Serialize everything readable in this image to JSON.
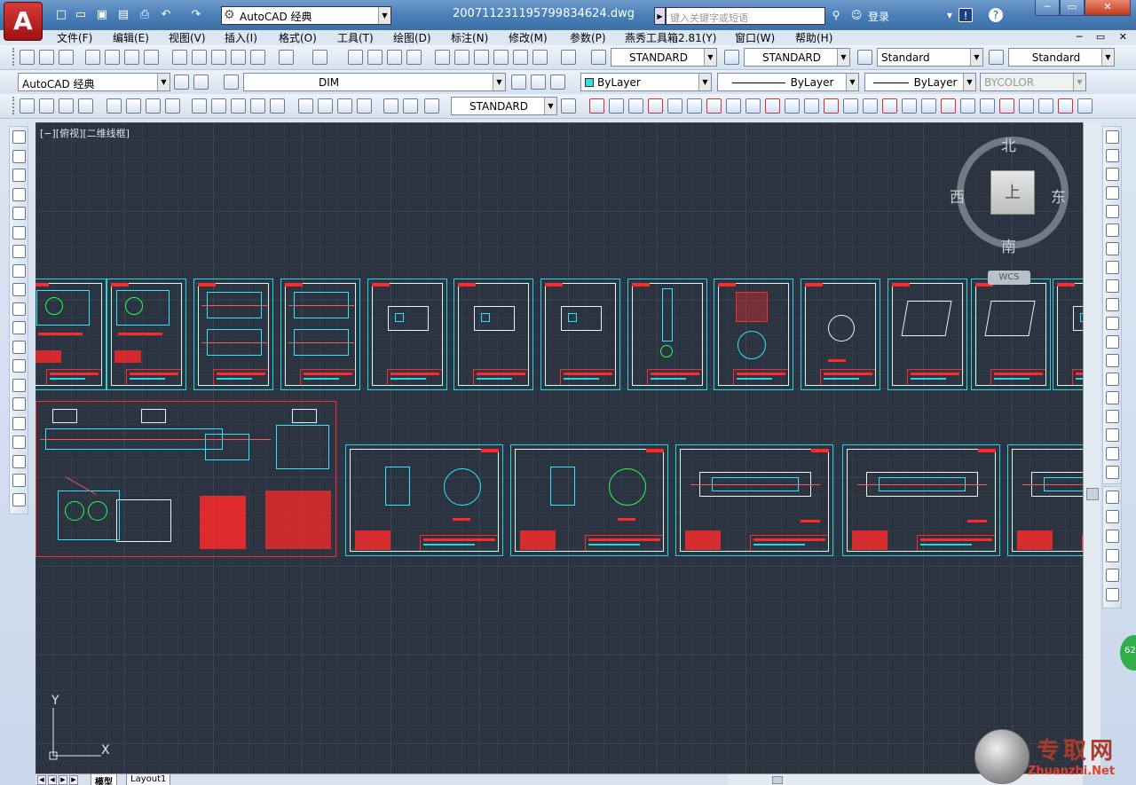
{
  "titlebar": {
    "workspace": "AutoCAD 经典",
    "doc_title": "20071123119579983­4624.dwg",
    "search_placeholder": "键入关键字或短语",
    "login_label": "登录"
  },
  "menubar": {
    "items": [
      "文件(F)",
      "编辑(E)",
      "视图(V)",
      "插入(I)",
      "格式(O)",
      "工具(T)",
      "绘图(D)",
      "标注(N)",
      "修改(M)",
      "参数(P)",
      "燕秀工具箱2.81(Y)",
      "窗口(W)",
      "帮助(H)"
    ]
  },
  "styles_toolbar": {
    "text_style": "STANDARD",
    "dim_style": "STANDARD",
    "table_style": "Standard",
    "mleader_style": "Standard"
  },
  "layers_toolbar": {
    "workspace": "AutoCAD 经典",
    "current_layer": "DIM",
    "color": "ByLayer",
    "linetype": "ByLayer",
    "lineweight": "ByLayer",
    "plotstyle": "BYCOLOR"
  },
  "dim_toolbar": {
    "dim_style": "STANDARD"
  },
  "viewport": {
    "label": "[−][俯视][二维线框]"
  },
  "viewcube": {
    "north": "北",
    "south": "南",
    "east": "东",
    "west": "西",
    "face": "上",
    "wcs": "WCS"
  },
  "ucs": {
    "x": "X",
    "y": "Y"
  },
  "tabs": {
    "model": "模型",
    "layout1": "Layout1"
  },
  "badge": "62",
  "watermark": {
    "cn": "专取网",
    "en": "Zhuanzhi.Net"
  },
  "colors": {
    "canvas": "#2b3440",
    "cyan_lines": "#22d6e6",
    "red_lines": "#ff2a2a",
    "green_lines": "#22ff55"
  },
  "icons": {
    "quick_access": [
      "new-icon",
      "open-icon",
      "save-icon",
      "saveas-icon",
      "print-icon",
      "undo-icon",
      "redo-icon"
    ],
    "help": [
      "binoculars-icon",
      "user-icon",
      "exchange-icon",
      "help-icon"
    ]
  }
}
